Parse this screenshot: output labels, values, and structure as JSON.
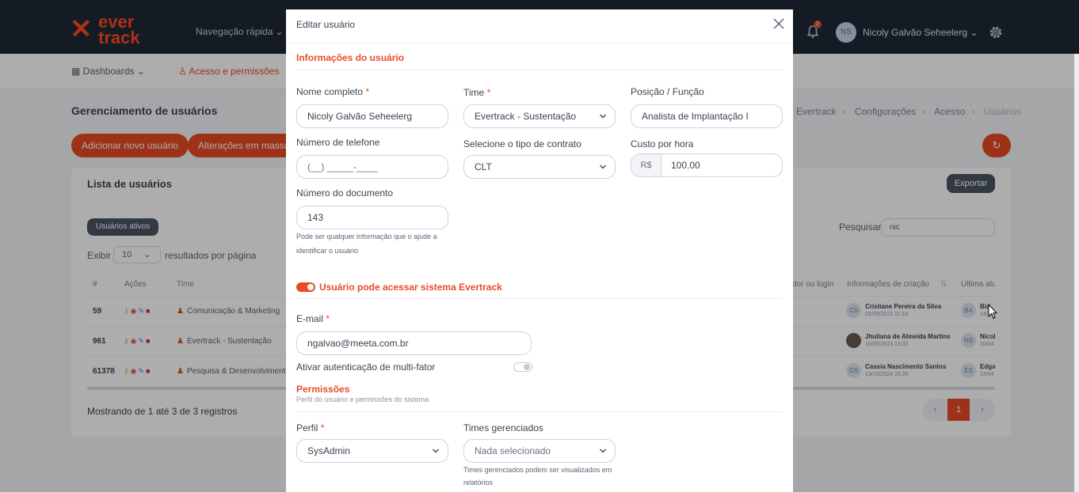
{
  "topbar": {
    "logo_top": "ever",
    "logo_bottom": "track",
    "quick_nav_label": "Navegação rápida",
    "notification_count": "2",
    "user_initials": "NS",
    "user_name": "Nicoly Galvão Seheelerg"
  },
  "subnav": {
    "dashboards_label": "Dashboards",
    "access_label": "Acesso e permissões"
  },
  "page": {
    "title": "Gerenciamento de usuários",
    "breadcrumbs": [
      "Evertrack",
      "Configurações",
      "Acesso",
      "Usuários"
    ],
    "add_user_label": "Adicionar novo usuário",
    "bulk_changes_label": "Alterações em massa",
    "refresh_icon": "refresh-icon"
  },
  "list": {
    "title": "Lista de usuários",
    "export_label": "Exportar",
    "active_filter_label": "Usuários ativos",
    "search_label": "Pesquisar",
    "search_value": "nic",
    "show_label": "Exibir",
    "page_size": "10",
    "page_size_suffix": "resultados por página",
    "columns": [
      "#",
      "Ações",
      "Time",
      "dor ou login",
      "Informações de criação",
      "Última atu"
    ],
    "rows": [
      {
        "id": "59",
        "team": "Comunicação & Marketing",
        "creator_initials": "CS",
        "creator": "Cristiane Pereira da Silva",
        "created": "01/09/2022 11:18",
        "updater_initials": "BA",
        "updater": "Bia",
        "updated": "14/"
      },
      {
        "id": "961",
        "team": "Evertrack - Sustentação",
        "creator_initials": "",
        "creator": "Jhuliana de Almeida Martins",
        "created": "10/05/2023 13:33",
        "updater_initials": "NS",
        "updater": "Nicol",
        "updated": "10/04"
      },
      {
        "id": "61378",
        "team": "Pesquisa & Desenvolvimento",
        "creator_initials": "CS",
        "creator": "Cassia Nascimento Santos",
        "created": "13/10/2024 15:20",
        "updater_initials": "ES",
        "updater": "Edga",
        "updated": "13/04"
      }
    ],
    "footer_info": "Mostrando de 1 até 3 de 3 registros",
    "pagination": {
      "prev": "‹",
      "current": "1",
      "next": "›"
    }
  },
  "modal": {
    "title": "Editar usuário",
    "section_info": "Informações do usuário",
    "full_name_label": "Nome completo",
    "full_name_value": "Nicoly Galvão Seheelerg",
    "team_label": "Time",
    "team_value": "Evertrack - Sustentação",
    "position_label": "Posição / Função",
    "position_value": "Analista de Implantação I",
    "phone_label": "Número de telefone",
    "phone_placeholder": "(__) _____-____",
    "contract_label": "Selecione o tipo de contrato",
    "contract_value": "CLT",
    "hourly_cost_label": "Custo por hora",
    "currency_prefix": "R$",
    "hourly_cost_value": "100.00",
    "document_label": "Número do documento",
    "document_value": "143",
    "document_help": "Pode ser qualquer informação que o ajude a identificar o usuário",
    "access_toggle_label": "Usuário pode acessar sistema Evertrack",
    "access_enabled": true,
    "email_label": "E-mail",
    "email_value": "ngalvao@meeta.com.br",
    "mfa_label": "Ativar autenticação de multi-fator",
    "mfa_enabled": false,
    "section_permissions": "Permissões",
    "permissions_subtitle": "Perfil do usuário e permissões do sistema",
    "profile_label": "Perfil",
    "profile_value": "SysAdmin",
    "managed_teams_label": "Times gerenciados",
    "managed_teams_value": "Nada selecionado",
    "managed_teams_help": "Times gerenciados podem ser visualizados em relatórios",
    "required_mark": "*"
  },
  "colors": {
    "accent": "#e94b26",
    "topbar": "#1e2936",
    "dark_button": "#4a5564"
  }
}
